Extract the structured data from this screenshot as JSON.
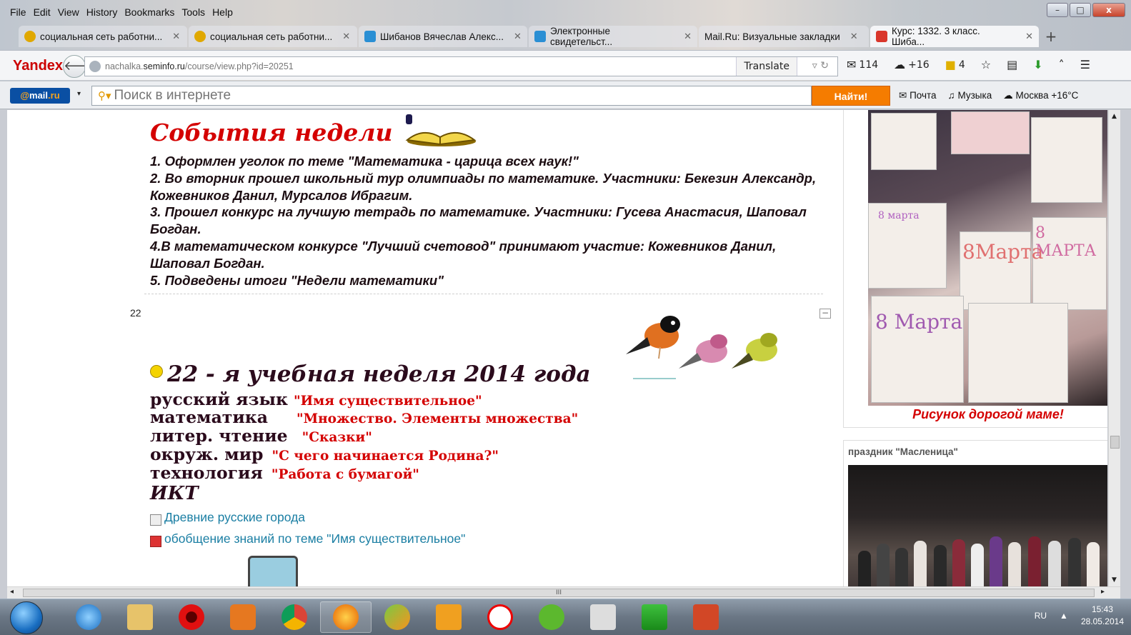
{
  "menu": [
    "File",
    "Edit",
    "View",
    "History",
    "Bookmarks",
    "Tools",
    "Help"
  ],
  "window_controls": {
    "minimize": "–",
    "maximize": "□",
    "close": "x"
  },
  "tabs": [
    {
      "label": "социальная сеть работни...",
      "icon": "search-favicon",
      "color": "#e0a800"
    },
    {
      "label": "социальная сеть работни...",
      "icon": "search-favicon",
      "color": "#e0a800"
    },
    {
      "label": "Шибанов Вячеслав Алекс...",
      "icon": "check-favicon",
      "color": "#2a8fd4"
    },
    {
      "label": "Электронные свидетельст...",
      "icon": "check-favicon",
      "color": "#2a8fd4"
    },
    {
      "label": "Mail.Ru: Визуальные закладки",
      "icon": "none",
      "color": "#cccccc"
    },
    {
      "label": "Курс: 1332. 3 класс. Шиба...",
      "icon": "moodle-favicon",
      "color": "#d9362b"
    }
  ],
  "new_tab": "+",
  "nav": {
    "logo": "Yandex",
    "url_gray": "nachalka.",
    "url_domain": "seminfo.ru",
    "url_path": "/course/view.php?id=20251",
    "translate": "Translate",
    "mail_count": "114",
    "weather": "+16",
    "tasks": "4"
  },
  "mailbar": {
    "logo_at": "@",
    "logo_text": "mail",
    "logo_ru": ".ru",
    "search_placeholder": "Поиск в интернете",
    "find_button": "Найти!",
    "links": [
      "Почта",
      "Музыка",
      "Москва +16°C"
    ]
  },
  "events": {
    "title": "События недели",
    "items": [
      "1. Оформлен уголок по теме \"Математика - царица всех наук!\"",
      "2. Во вторник прошел школьный тур олимпиады по математике. Участники: Бекезин Александр, Кожевников Данил, Мурсалов Ибрагим.",
      "3. Прошел конкурс на лучшую тетрадь по математике. Участники: Гусева Анастасия, Шаповал Богдан.",
      "4.В математическом конкурсе \"Лучший счетовод\" принимают участие: Кожевников Данил, Шаповал Богдан.",
      "5. Подведены итоги \"Недели математики\""
    ]
  },
  "section": {
    "number": "22",
    "collapse": "−",
    "title": "22 - я учебная неделя 2014 года",
    "subjects": [
      {
        "name": "русский язык",
        "topic": "\"Имя существительное\""
      },
      {
        "name": "математика",
        "topic": "\"Множество. Элементы множества\""
      },
      {
        "name": "литер. чтение",
        "topic": "\"Сказки\""
      },
      {
        "name": "окруж. мир",
        "topic": "\"С чего начинается Родина?\""
      },
      {
        "name": "технология",
        "topic": "\"Работа с бумагой\""
      }
    ],
    "ikt": "ИКТ",
    "resources": [
      "Древние русские города",
      "обобщение знаний по теме \"Имя существительное\""
    ]
  },
  "sidebar": {
    "caption": "Рисунок дорогой маме!",
    "block2_title": "праздник \"Масленица\"",
    "drawing_text": [
      "8 марта",
      "8Марта",
      "8 МАРТА",
      "8 Марта"
    ]
  },
  "hscroll_grip": "III",
  "tray": {
    "lang": "RU",
    "time": "15:43",
    "date": "28.05.2014"
  }
}
